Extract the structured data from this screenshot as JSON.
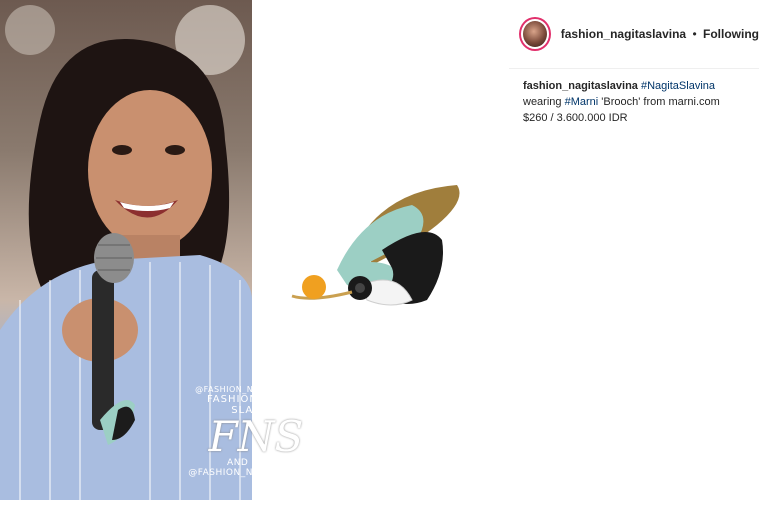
{
  "post": {
    "username": "fashion_nagitaslavina",
    "separator": "•",
    "follow_status": "Following"
  },
  "caption": {
    "username": "fashion_nagitaslavina",
    "hashtag_name": "#NagitaSlavina",
    "line2_prefix": "wearing",
    "hashtag_brand": "#Marni",
    "line2_suffix": "'Brooch' from marni.com",
    "price": "$260 / 3.600.000 IDR"
  },
  "watermark": {
    "handle_top": "@FASHION_NAGITASLAVINA",
    "title": "FASHION NAGITA SLAVINA",
    "logo": "FNS",
    "subtitle": "AND FAMILY",
    "handle_bottom": "@FASHION_NAGITASLAVINA"
  },
  "colors": {
    "accent_link": "#003569",
    "avatar_ring": "#e1306c",
    "brooch_gold": "#a07e3c",
    "brooch_mint": "#9ccfc4",
    "brooch_orange": "#f0a020"
  }
}
